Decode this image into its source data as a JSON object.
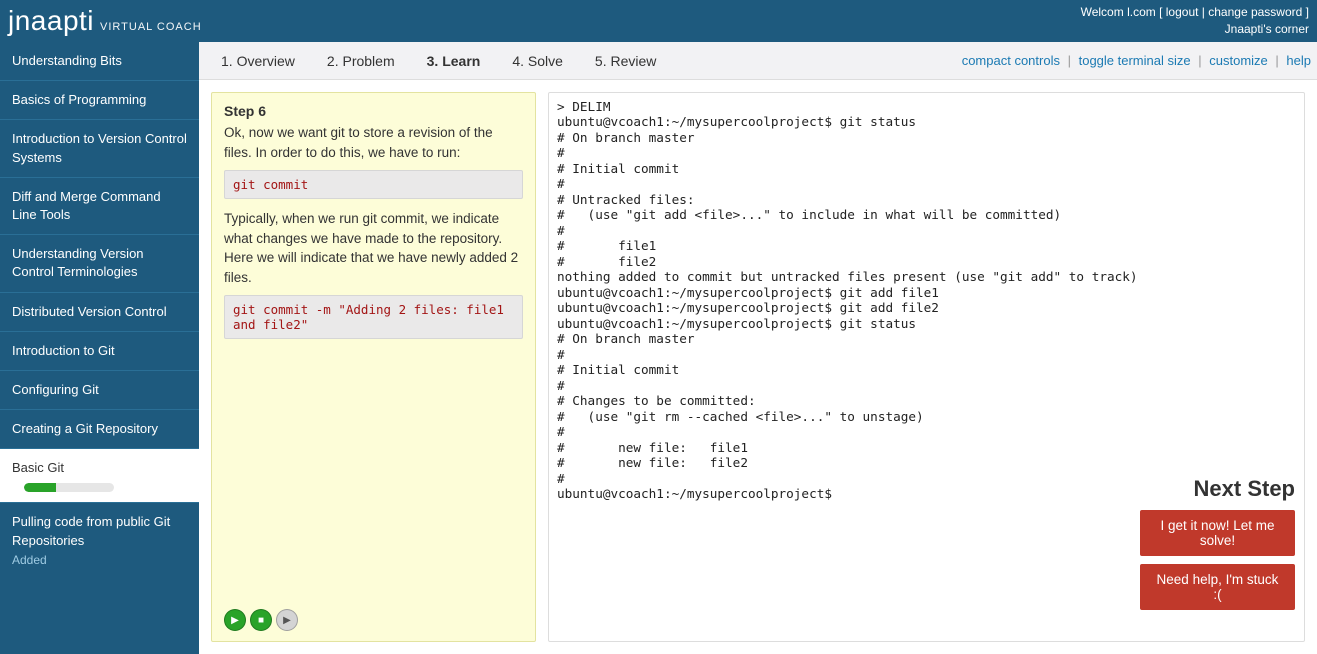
{
  "brand": {
    "name": "jnaapti",
    "sub": "VIRTUAL COACH"
  },
  "header": {
    "welcome_prefix": "Welcom",
    "welcome_suffix": "l.com [ ",
    "logout": "logout",
    "sep": " | ",
    "change_password": "change password",
    "bracket_close": " ]",
    "corner": "Jnaapti's corner"
  },
  "sidebar": {
    "items": [
      {
        "label": "Understanding Bits"
      },
      {
        "label": "Basics of Programming"
      },
      {
        "label": "Introduction to Version Control Systems"
      },
      {
        "label": "Diff and Merge Command Line Tools"
      },
      {
        "label": "Understanding Version Control Terminologies"
      },
      {
        "label": "Distributed Version Control"
      },
      {
        "label": "Introduction to Git"
      },
      {
        "label": "Configuring Git"
      },
      {
        "label": "Creating a Git Repository"
      },
      {
        "label": "Basic Git",
        "active": true,
        "progress_pct": 35
      },
      {
        "label": "Pulling code from public Git Repositories",
        "added_label": "Added"
      }
    ]
  },
  "tabs": [
    {
      "label": "1. Overview"
    },
    {
      "label": "2. Problem"
    },
    {
      "label": "3. Learn",
      "active": true
    },
    {
      "label": "4. Solve"
    },
    {
      "label": "5. Review"
    }
  ],
  "controls": {
    "compact": "compact controls",
    "toggle_term": "toggle terminal size",
    "customize": "customize",
    "help": "help"
  },
  "step": {
    "title": "Step 6",
    "intro": "Ok, now we want git to store a revision of the files. In order to do this, we have to run:",
    "cmd1": "git commit",
    "mid": "Typically, when we run git commit, we indicate what changes we have made to the repository. Here we will indicate that we have newly added 2 files.",
    "cmd2": "git commit -m \"Adding 2 files: file1 and file2\""
  },
  "nav_btns": {
    "prev_icon": "▶",
    "pause_icon": "■",
    "next_icon": "▶"
  },
  "next_step": {
    "heading": "Next Step",
    "solve": "I get it now! Let me solve!",
    "stuck": "Need help, I'm stuck :("
  },
  "terminal_lines": [
    "> DELIM",
    "ubuntu@vcoach1:~/mysupercoolproject$ git status",
    "# On branch master",
    "#",
    "# Initial commit",
    "#",
    "# Untracked files:",
    "#   (use \"git add <file>...\" to include in what will be committed)",
    "#",
    "#       file1",
    "#       file2",
    "nothing added to commit but untracked files present (use \"git add\" to track)",
    "ubuntu@vcoach1:~/mysupercoolproject$ git add file1",
    "ubuntu@vcoach1:~/mysupercoolproject$ git add file2",
    "ubuntu@vcoach1:~/mysupercoolproject$ git status",
    "# On branch master",
    "#",
    "# Initial commit",
    "#",
    "# Changes to be committed:",
    "#   (use \"git rm --cached <file>...\" to unstage)",
    "#",
    "#       new file:   file1",
    "#       new file:   file2",
    "#",
    "ubuntu@vcoach1:~/mysupercoolproject$ "
  ]
}
